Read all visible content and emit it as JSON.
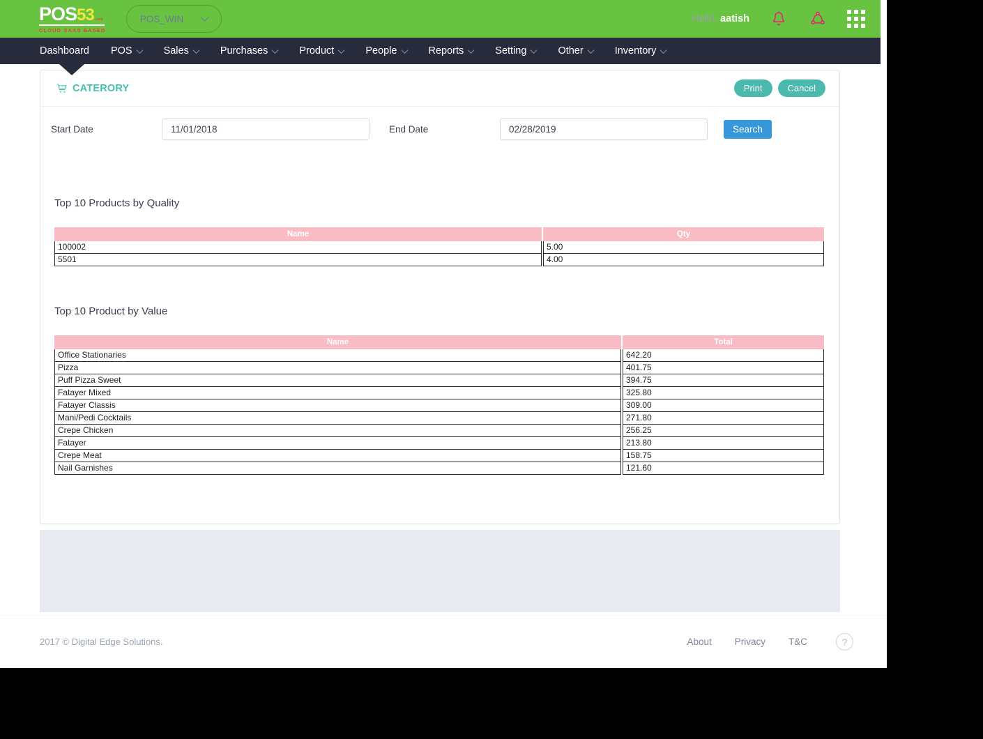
{
  "brand": {
    "logo_primary": "POS",
    "logo_accent": "53",
    "logo_dotcom": ".com",
    "logo_tagline": "CLOUD SAAS BASED",
    "green": "#68c341",
    "navy": "#282b3c",
    "teal": "#4bb9ad",
    "blue": "#3697db",
    "pink": "#f9bcc5"
  },
  "topbar": {
    "store_selector": "POS_WIN",
    "greeting_prefix": "Hello,",
    "user_name": "aatish",
    "bell_icon": "bell-icon",
    "share_icon": "share-nodes-icon",
    "apps_icon": "apps-grid-icon"
  },
  "nav": {
    "items": [
      {
        "label": "Dashboard",
        "has_caret": false,
        "active": true
      },
      {
        "label": "POS",
        "has_caret": true,
        "active": false
      },
      {
        "label": "Sales",
        "has_caret": true,
        "active": false
      },
      {
        "label": "Purchases",
        "has_caret": true,
        "active": false
      },
      {
        "label": "Product",
        "has_caret": true,
        "active": false
      },
      {
        "label": "People",
        "has_caret": true,
        "active": false
      },
      {
        "label": "Reports",
        "has_caret": true,
        "active": false
      },
      {
        "label": "Setting",
        "has_caret": true,
        "active": false
      },
      {
        "label": "Other",
        "has_caret": true,
        "active": false
      },
      {
        "label": "Inventory",
        "has_caret": true,
        "active": false
      }
    ]
  },
  "card": {
    "title": "CATERORY",
    "title_icon": "shopping-cart-icon",
    "print_label": "Print",
    "cancel_label": "Cancel"
  },
  "filters": {
    "start_label": "Start Date",
    "start_value": "11/01/2018",
    "start_placeholder": "Start Date",
    "end_label": "End Date",
    "end_value": "02/28/2019",
    "end_placeholder": "End Date",
    "search_label": "Search"
  },
  "quality_section": {
    "title": "Top 10 Products by Quality",
    "columns": [
      "Name",
      "Qty"
    ],
    "rows": [
      [
        "100002",
        "5.00"
      ],
      [
        "5501",
        "4.00"
      ]
    ]
  },
  "value_section": {
    "title": "Top 10 Product by Value",
    "columns": [
      "Name",
      "Total"
    ],
    "rows": [
      [
        "Office Stationaries",
        "642.20"
      ],
      [
        "Pizza",
        "401.75"
      ],
      [
        "Puff Pizza Sweet",
        "394.75"
      ],
      [
        "Fatayer Mixed",
        "325.80"
      ],
      [
        "Fatayer Classis",
        "309.00"
      ],
      [
        "Mani/Pedi Cocktails",
        "271.80"
      ],
      [
        "Crepe Chicken",
        "256.25"
      ],
      [
        "Fatayer",
        "213.80"
      ],
      [
        "Crepe Meat",
        "158.75"
      ],
      [
        "Nail Garnishes",
        "121.60"
      ]
    ]
  },
  "footer": {
    "copyright": "2017 © Digital Edge Solutions.",
    "links": [
      "About",
      "Privacy",
      "T&C"
    ],
    "help_glyph": "?"
  }
}
